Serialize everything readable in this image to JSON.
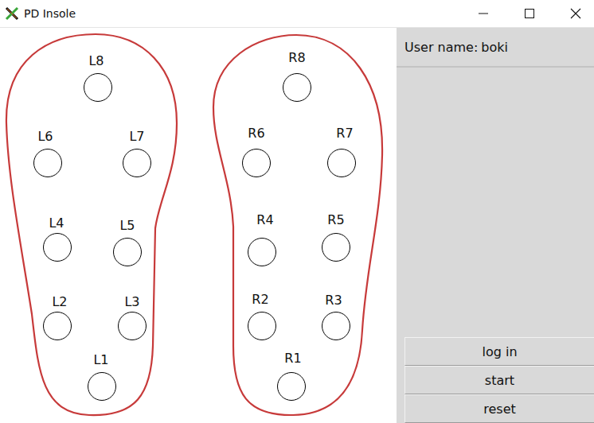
{
  "window": {
    "title": "PD Insole"
  },
  "user": {
    "label": "User name:",
    "value": "boki"
  },
  "left_sensors": [
    {
      "label": "L1"
    },
    {
      "label": "L2"
    },
    {
      "label": "L3"
    },
    {
      "label": "L4"
    },
    {
      "label": "L5"
    },
    {
      "label": "L6"
    },
    {
      "label": "L7"
    },
    {
      "label": "L8"
    }
  ],
  "right_sensors": [
    {
      "label": "R1"
    },
    {
      "label": "R2"
    },
    {
      "label": "R3"
    },
    {
      "label": "R4"
    },
    {
      "label": "R5"
    },
    {
      "label": "R6"
    },
    {
      "label": "R7"
    },
    {
      "label": "R8"
    }
  ],
  "buttons": [
    "log in",
    "start",
    "reset"
  ]
}
